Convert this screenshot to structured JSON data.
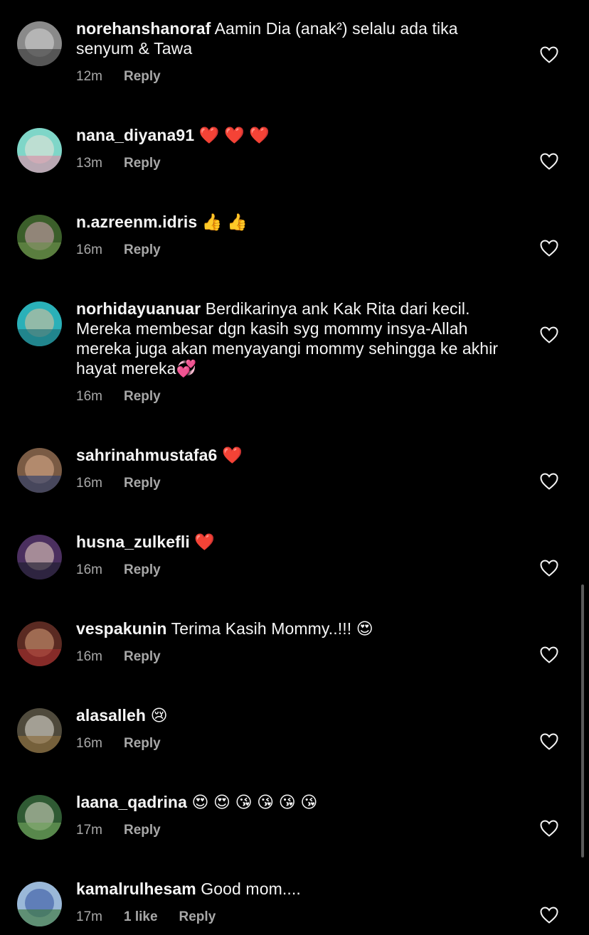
{
  "comments": [
    {
      "username": "norehanshanoraf",
      "text": "Aamin Dia (anak²) selalu ada tika senyum & Tawa",
      "time": "12m",
      "likes": "",
      "reply": "Reply",
      "avatar_colors": [
        "#8a8a8a",
        "#d8d8d8",
        "#3a3a3a"
      ]
    },
    {
      "username": "nana_diyana91",
      "text": "❤️ ❤️ ❤️",
      "time": "13m",
      "likes": "",
      "reply": "Reply",
      "avatar_colors": [
        "#7fd6c8",
        "#f1e6da",
        "#d88fa8"
      ]
    },
    {
      "username": "n.azreenm.idris",
      "text": "👍 👍",
      "time": "16m",
      "likes": "",
      "reply": "Reply",
      "avatar_colors": [
        "#3b5e2a",
        "#d9a6b8",
        "#6b8f4b"
      ]
    },
    {
      "username": "norhidayuanuar",
      "text": "Berdikarinya ank Kak Rita dari kecil. Mereka membesar dgn kasih syg mommy insya-Allah mereka juga akan menyayangi mommy sehingga ke akhir hayat mereka💞",
      "time": "16m",
      "likes": "",
      "reply": "Reply",
      "avatar_colors": [
        "#2ab0b8",
        "#e8c29a",
        "#1d6f77"
      ]
    },
    {
      "username": "sahrinahmustafa6",
      "text": "❤️",
      "time": "16m",
      "likes": "",
      "reply": "Reply",
      "avatar_colors": [
        "#7a5b44",
        "#e0b090",
        "#2d3d6a"
      ]
    },
    {
      "username": "husna_zulkefli",
      "text": "❤️",
      "time": "16m",
      "likes": "",
      "reply": "Reply",
      "avatar_colors": [
        "#4b2f5f",
        "#f0d7c5",
        "#1f1f2f"
      ]
    },
    {
      "username": "vespakunin",
      "text": "Terima Kasih Mommy..!!! 😍",
      "time": "16m",
      "likes": "",
      "reply": "Reply",
      "avatar_colors": [
        "#5a2a22",
        "#d8a07a",
        "#9e2c2c"
      ]
    },
    {
      "username": "alasalleh",
      "text": "😢",
      "time": "16m",
      "likes": "",
      "reply": "Reply",
      "avatar_colors": [
        "#4f4a3c",
        "#eae6dc",
        "#8b6b3a"
      ]
    },
    {
      "username": "laana_qadrina",
      "text": "😍 😍 😘 😘 😘 😘",
      "time": "17m",
      "likes": "",
      "reply": "Reply",
      "avatar_colors": [
        "#2f5a33",
        "#dcdcc8",
        "#6fa25a"
      ]
    },
    {
      "username": "kamalrulhesam",
      "text": "Good mom....",
      "time": "17m",
      "likes": "1 like",
      "reply": "Reply",
      "avatar_colors": [
        "#9ab8d8",
        "#2f4f9f",
        "#3f7a3f"
      ]
    }
  ],
  "icons": {
    "like": "heart-outline-icon"
  },
  "colors": {
    "background": "#000000",
    "text": "#f5f5f5",
    "meta": "#a8a8a8"
  }
}
